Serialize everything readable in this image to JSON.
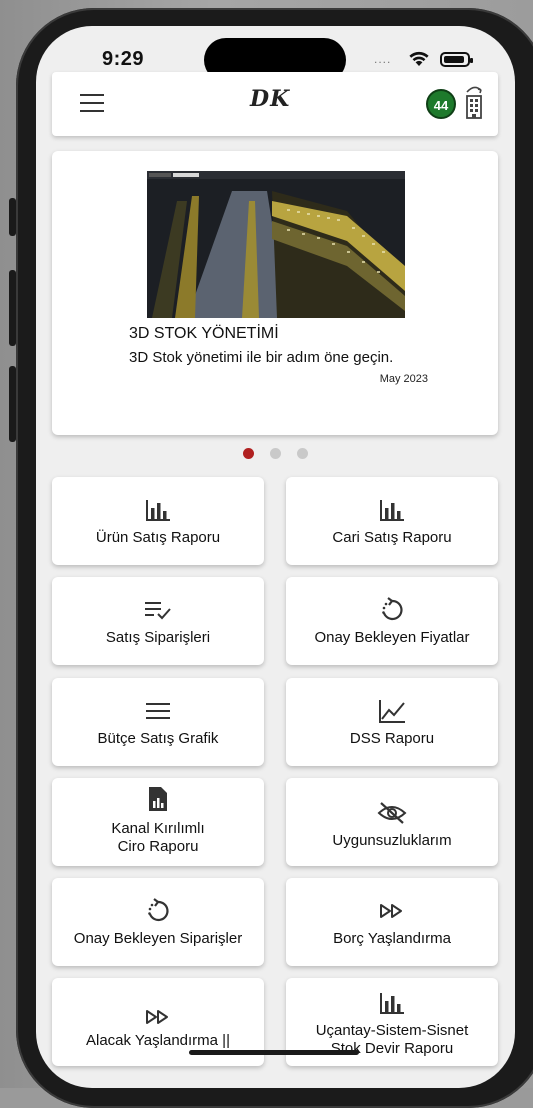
{
  "status_bar": {
    "time": "9:29",
    "signal": "...."
  },
  "app_bar": {
    "logo_text": "DK",
    "notification_count": "44"
  },
  "carousel": {
    "title": "3D STOK YÖNETİMİ",
    "text": "3D Stok yönetimi ile bir adım öne geçin.",
    "date": "May 2023",
    "page_count": 3,
    "active_page": 1
  },
  "tiles": [
    {
      "label": "Ürün Satış Raporu",
      "icon": "bar-chart-icon"
    },
    {
      "label": "Cari Satış Raporu",
      "icon": "bar-chart-icon"
    },
    {
      "label": "Satış Siparişleri",
      "icon": "list-check-icon"
    },
    {
      "label": "Onay Bekleyen Fiyatlar",
      "icon": "pending-refresh-icon"
    },
    {
      "label": "Bütçe Satış Grafik",
      "icon": "menu-lines-icon"
    },
    {
      "label": "DSS Raporu",
      "icon": "line-chart-icon"
    },
    {
      "label": "Kanal Kırılımlı",
      "label2": "Ciro Raporu",
      "icon": "report-file-icon"
    },
    {
      "label": "Uygunsuzluklarım",
      "icon": "eye-off-icon"
    },
    {
      "label": "Onay Bekleyen Siparişler",
      "icon": "pending-refresh-icon"
    },
    {
      "label": "Borç Yaşlandırma",
      "icon": "fast-forward-icon"
    },
    {
      "label": "Alacak Yaşlandırma ||",
      "icon": "fast-forward-icon"
    },
    {
      "label": "Uçantay-Sistem-Sisnet",
      "label2": "Stok Devir Raporu",
      "icon": "bar-chart-icon"
    }
  ],
  "colors": {
    "accent_red": "#b02020",
    "badge_green": "#1e7a2c",
    "background": "#efefef"
  }
}
